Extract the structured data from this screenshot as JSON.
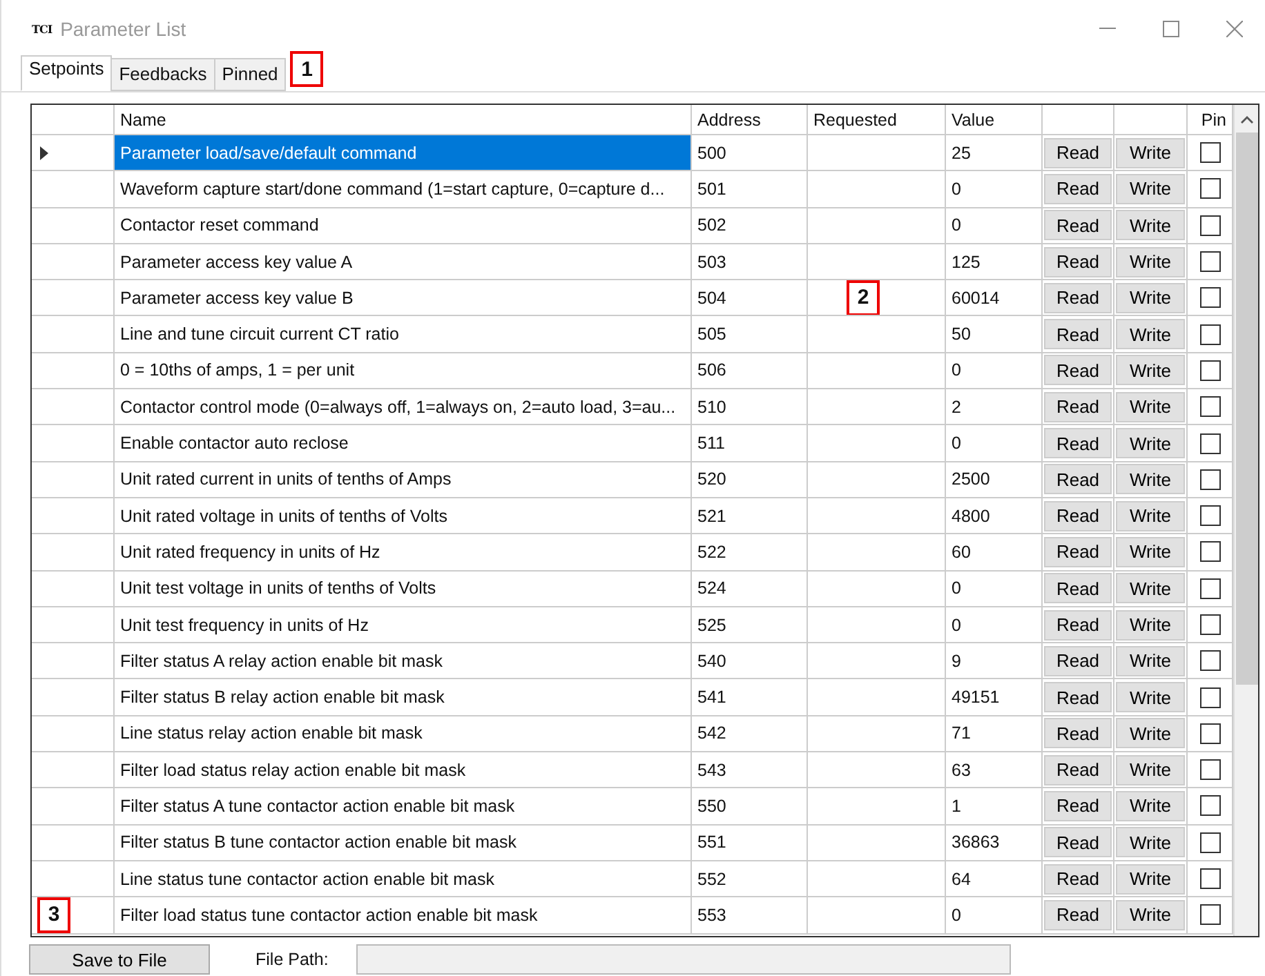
{
  "window": {
    "logo": "TCI",
    "title": "Parameter List"
  },
  "tabs": [
    {
      "label": "Setpoints",
      "selected": true
    },
    {
      "label": "Feedbacks",
      "selected": false
    },
    {
      "label": "Pinned",
      "selected": false
    }
  ],
  "tabs_callout": "1",
  "table": {
    "columns": [
      "Name",
      "Address",
      "Requested",
      "Value",
      "Pin"
    ],
    "rows": [
      {
        "selected": true,
        "name": "Parameter load/save/default command",
        "address": "500",
        "value": "25",
        "read": "Read",
        "write": "Write",
        "pinned": false
      },
      {
        "selected": false,
        "name": "Waveform capture start/done command (1=start capture, 0=capture d...",
        "address": "501",
        "value": "0",
        "read": "Read",
        "write": "Write",
        "pinned": false
      },
      {
        "selected": false,
        "name": "Contactor reset command",
        "address": "502",
        "value": "0",
        "read": "Read",
        "write": "Write",
        "pinned": false
      },
      {
        "selected": false,
        "name": "Parameter access key value A",
        "address": "503",
        "value": "125",
        "read": "Read",
        "write": "Write",
        "pinned": false
      },
      {
        "selected": false,
        "name": "Parameter access key value B",
        "address": "504",
        "requested_callout": "2",
        "value": "60014",
        "read": "Read",
        "write": "Write",
        "pinned": false
      },
      {
        "selected": false,
        "name": "Line and tune circuit current CT ratio",
        "address": "505",
        "value": "50",
        "read": "Read",
        "write": "Write",
        "pinned": false
      },
      {
        "selected": false,
        "name": "0 = 10ths of amps, 1 = per unit",
        "address": "506",
        "value": "0",
        "read": "Read",
        "write": "Write",
        "pinned": false
      },
      {
        "selected": false,
        "name": "Contactor control mode (0=always off, 1=always on, 2=auto load, 3=au...",
        "address": "510",
        "value": "2",
        "read": "Read",
        "write": "Write",
        "pinned": false
      },
      {
        "selected": false,
        "name": "Enable contactor auto reclose",
        "address": "511",
        "value": "0",
        "read": "Read",
        "write": "Write",
        "pinned": false
      },
      {
        "selected": false,
        "name": "Unit rated current in units of tenths of Amps",
        "address": "520",
        "value": "2500",
        "read": "Read",
        "write": "Write",
        "pinned": false
      },
      {
        "selected": false,
        "name": "Unit rated voltage in units of tenths of Volts",
        "address": "521",
        "value": "4800",
        "read": "Read",
        "write": "Write",
        "pinned": false
      },
      {
        "selected": false,
        "name": "Unit rated frequency in units of Hz",
        "address": "522",
        "value": "60",
        "read": "Read",
        "write": "Write",
        "pinned": false
      },
      {
        "selected": false,
        "name": "Unit test voltage in units of tenths of Volts",
        "address": "524",
        "value": "0",
        "read": "Read",
        "write": "Write",
        "pinned": false
      },
      {
        "selected": false,
        "name": "Unit test frequency in units of Hz",
        "address": "525",
        "value": "0",
        "read": "Read",
        "write": "Write",
        "pinned": false
      },
      {
        "selected": false,
        "name": "Filter status A relay action enable bit mask",
        "address": "540",
        "value": "9",
        "read": "Read",
        "write": "Write",
        "pinned": false
      },
      {
        "selected": false,
        "name": "Filter status B relay action enable bit mask",
        "address": "541",
        "value": "49151",
        "read": "Read",
        "write": "Write",
        "pinned": false
      },
      {
        "selected": false,
        "name": "Line status relay action enable bit mask",
        "address": "542",
        "value": "71",
        "read": "Read",
        "write": "Write",
        "pinned": false
      },
      {
        "selected": false,
        "name": "Filter load status relay action enable bit mask",
        "address": "543",
        "value": "63",
        "read": "Read",
        "write": "Write",
        "pinned": false
      },
      {
        "selected": false,
        "name": "Filter status A tune contactor action enable bit mask",
        "address": "550",
        "value": "1",
        "read": "Read",
        "write": "Write",
        "pinned": false
      },
      {
        "selected": false,
        "name": "Filter status B tune contactor action enable bit mask",
        "address": "551",
        "value": "36863",
        "read": "Read",
        "write": "Write",
        "pinned": false
      },
      {
        "selected": false,
        "name": "Line status tune contactor action enable bit mask",
        "address": "552",
        "value": "64",
        "read": "Read",
        "write": "Write",
        "pinned": false
      },
      {
        "selected": false,
        "row_callout": "3",
        "name": "Filter load status tune contactor action enable bit mask",
        "address": "553",
        "value": "0",
        "read": "Read",
        "write": "Write",
        "pinned": false
      }
    ]
  },
  "footer": {
    "save_button": "Save to File",
    "file_path_label": "File Path:"
  }
}
